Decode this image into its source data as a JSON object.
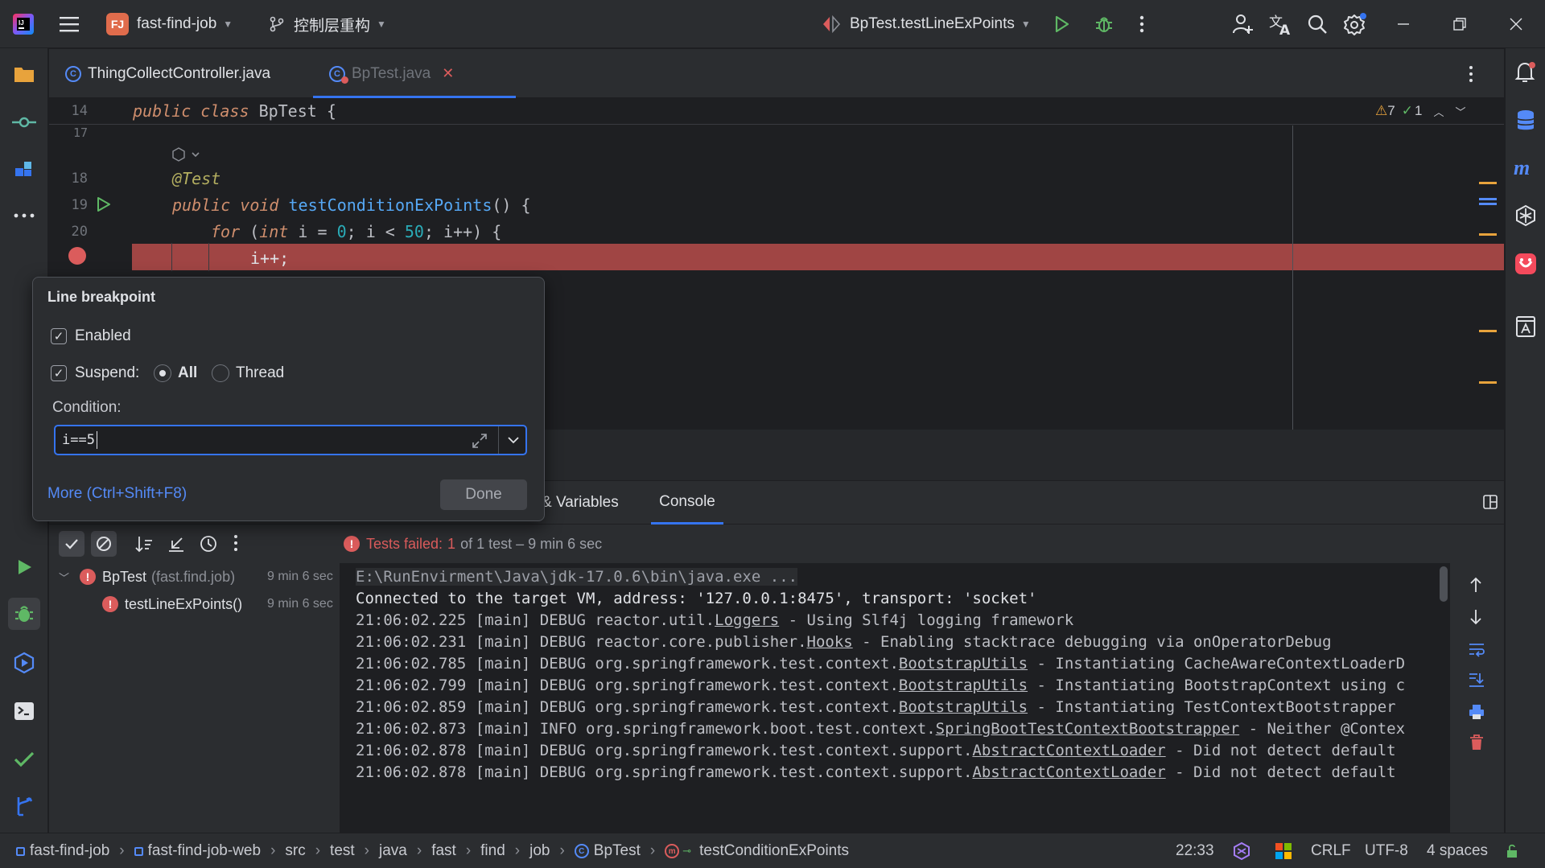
{
  "titlebar": {
    "project_badge": "FJ",
    "project_name": "fast-find-job",
    "branch": "控制层重构",
    "run_config": "BpTest.testLineExPoints"
  },
  "tabs": [
    {
      "label": "ThingCollectController.java",
      "icon": "class-icon"
    },
    {
      "label": "BpTest.java",
      "icon": "class-icon"
    }
  ],
  "inspections": {
    "warnings": "7",
    "ok": "1"
  },
  "editor": {
    "lines": [
      {
        "num": "14",
        "code": "public class BpTest {"
      },
      {
        "num": "17",
        "code": ""
      },
      {
        "num": "18",
        "code": "@Test"
      },
      {
        "num": "19",
        "code": "public void testConditionExPoints() {"
      },
      {
        "num": "20",
        "code": "for (int i = 0; i < 50; i++) {"
      },
      {
        "num": "",
        "code": "i++;"
      }
    ],
    "tok": {
      "public": "public",
      "class": "class",
      "cls_name": "BpTest",
      "brace": " {",
      "test_ann": "@Test",
      "void": "void",
      "method": "testConditionExPoints",
      "paren_brace": "() {",
      "for": "for",
      "open": " (",
      "int": "int",
      "p1": " i = ",
      "zero": "0",
      "p2": "; i < ",
      "fifty": "50",
      "p3": "; i++) {",
      "inc": "i++;"
    }
  },
  "breakpoint_popup": {
    "title": "Line breakpoint",
    "enabled_label": "Enabled",
    "suspend_label": "Suspend:",
    "all_label": "All",
    "thread_label": "Thread",
    "condition_label": "Condition:",
    "condition_value": "i==5",
    "more_link": "More (Ctrl+Shift+F8)",
    "done_label": "Done"
  },
  "debug": {
    "tab_variables": "& Variables",
    "tab_console": "Console",
    "tests_failed": "Tests failed:",
    "failed_count": "1",
    "of_text": "of 1 test – 9 min 6 sec",
    "tree": [
      {
        "label": "BpTest",
        "sub": "(fast.find.job)",
        "time": "9 min 6 sec"
      },
      {
        "label": "testLineExPoints()",
        "time": "9 min 6 sec"
      }
    ]
  },
  "console": {
    "l1": "E:\\RunEnvirment\\Java\\jdk-17.0.6\\bin\\java.exe ...",
    "l2": "Connected to the target VM, address: '127.0.0.1:8475', transport: 'socket'",
    "logs": [
      {
        "pre": "21:06:02.225 [main] DEBUG reactor.util.",
        "cls": "Loggers",
        "post": " - Using Slf4j logging framework"
      },
      {
        "pre": "21:06:02.231 [main] DEBUG reactor.core.publisher.",
        "cls": "Hooks",
        "post": " - Enabling stacktrace debugging via onOperatorDebug"
      },
      {
        "pre": "21:06:02.785 [main] DEBUG org.springframework.test.context.",
        "cls": "BootstrapUtils",
        "post": " - Instantiating CacheAwareContextLoaderD"
      },
      {
        "pre": "21:06:02.799 [main] DEBUG org.springframework.test.context.",
        "cls": "BootstrapUtils",
        "post": " - Instantiating BootstrapContext using c"
      },
      {
        "pre": "21:06:02.859 [main] DEBUG org.springframework.test.context.",
        "cls": "BootstrapUtils",
        "post": " - Instantiating TestContextBootstrapper"
      },
      {
        "pre": "21:06:02.873 [main] INFO org.springframework.boot.test.context.",
        "cls": "SpringBootTestContextBootstrapper",
        "post": " - Neither @Contex"
      },
      {
        "pre": "21:06:02.878 [main] DEBUG org.springframework.test.context.support.",
        "cls": "AbstractContextLoader",
        "post": " - Did not detect default"
      },
      {
        "pre": "21:06:02.878 [main] DEBUG org.springframework.test.context.support.",
        "cls": "AbstractContextLoader",
        "post": " - Did not detect default"
      }
    ]
  },
  "statusbar": {
    "crumbs": [
      "fast-find-job",
      "fast-find-job-web",
      "src",
      "test",
      "java",
      "fast",
      "find",
      "job",
      "BpTest",
      "testConditionExPoints"
    ],
    "position": "22:33",
    "line_sep": "CRLF",
    "encoding": "UTF-8",
    "indent": "4 spaces"
  },
  "colors": {
    "accent": "#3574f0",
    "breakpoint": "#db5c5c",
    "run": "#5fb865",
    "error": "#db5c5c"
  }
}
